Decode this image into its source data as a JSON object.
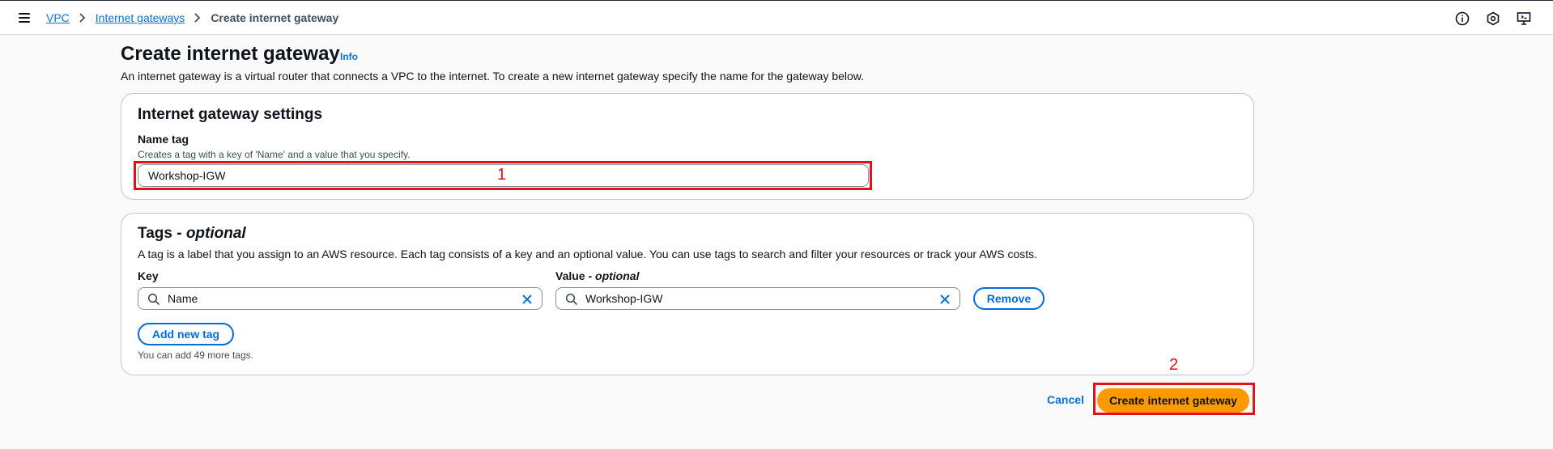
{
  "breadcrumb": {
    "items": [
      "VPC",
      "Internet gateways"
    ],
    "current": "Create internet gateway"
  },
  "header": {
    "title": "Create internet gateway",
    "info": "Info",
    "description": "An internet gateway is a virtual router that connects a VPC to the internet. To create a new internet gateway specify the name for the gateway below."
  },
  "settings": {
    "heading": "Internet gateway settings",
    "name_tag_label": "Name tag",
    "name_tag_hint": "Creates a tag with a key of 'Name' and a value that you specify.",
    "name_tag_value": "Workshop-IGW"
  },
  "tags": {
    "heading_main": "Tags - ",
    "heading_optional": "optional",
    "description": "A tag is a label that you assign to an AWS resource. Each tag consists of a key and an optional value. You can use tags to search and filter your resources or track your AWS costs.",
    "key_label": "Key",
    "value_label_main": "Value - ",
    "value_label_optional": "optional",
    "rows": [
      {
        "key": "Name",
        "value": "Workshop-IGW"
      }
    ],
    "remove_label": "Remove",
    "add_label": "Add new tag",
    "remaining_note": "You can add 49 more tags."
  },
  "actions": {
    "cancel": "Cancel",
    "submit": "Create internet gateway"
  },
  "annotations": {
    "marker_1": "1",
    "marker_2": "2"
  },
  "icons": [
    "menu-icon",
    "chevron-right-icon",
    "info-circle-icon",
    "settings-hex-icon",
    "screen-icon",
    "search-icon",
    "close-icon"
  ],
  "colors": {
    "link": "#0972d3",
    "primary_button": "#ff9900",
    "highlight": "#e0131b"
  }
}
